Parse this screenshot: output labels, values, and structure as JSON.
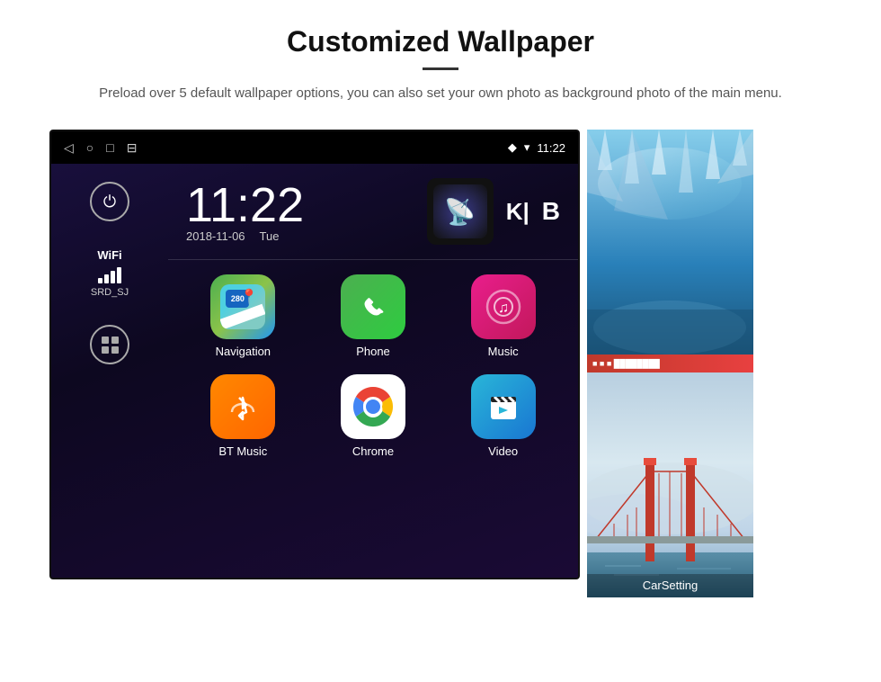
{
  "header": {
    "title": "Customized Wallpaper",
    "description": "Preload over 5 default wallpaper options, you can also set your own photo as background photo of the main menu."
  },
  "statusBar": {
    "time": "11:22",
    "navIcons": [
      "◁",
      "○",
      "□",
      "⊟"
    ],
    "rightIcons": [
      "location",
      "wifi",
      "time"
    ]
  },
  "clock": {
    "time": "11:22",
    "date": "2018-11-06",
    "day": "Tue"
  },
  "wifi": {
    "label": "WiFi",
    "ssid": "SRD_SJ"
  },
  "apps": [
    {
      "name": "Navigation",
      "type": "navigation"
    },
    {
      "name": "Phone",
      "type": "phone"
    },
    {
      "name": "Music",
      "type": "music"
    },
    {
      "name": "BT Music",
      "type": "btmusic"
    },
    {
      "name": "Chrome",
      "type": "chrome"
    },
    {
      "name": "Video",
      "type": "video"
    }
  ],
  "wallpapers": [
    {
      "name": "Ice Cave",
      "type": "ice"
    },
    {
      "name": "CarSetting",
      "type": "bridge"
    }
  ]
}
